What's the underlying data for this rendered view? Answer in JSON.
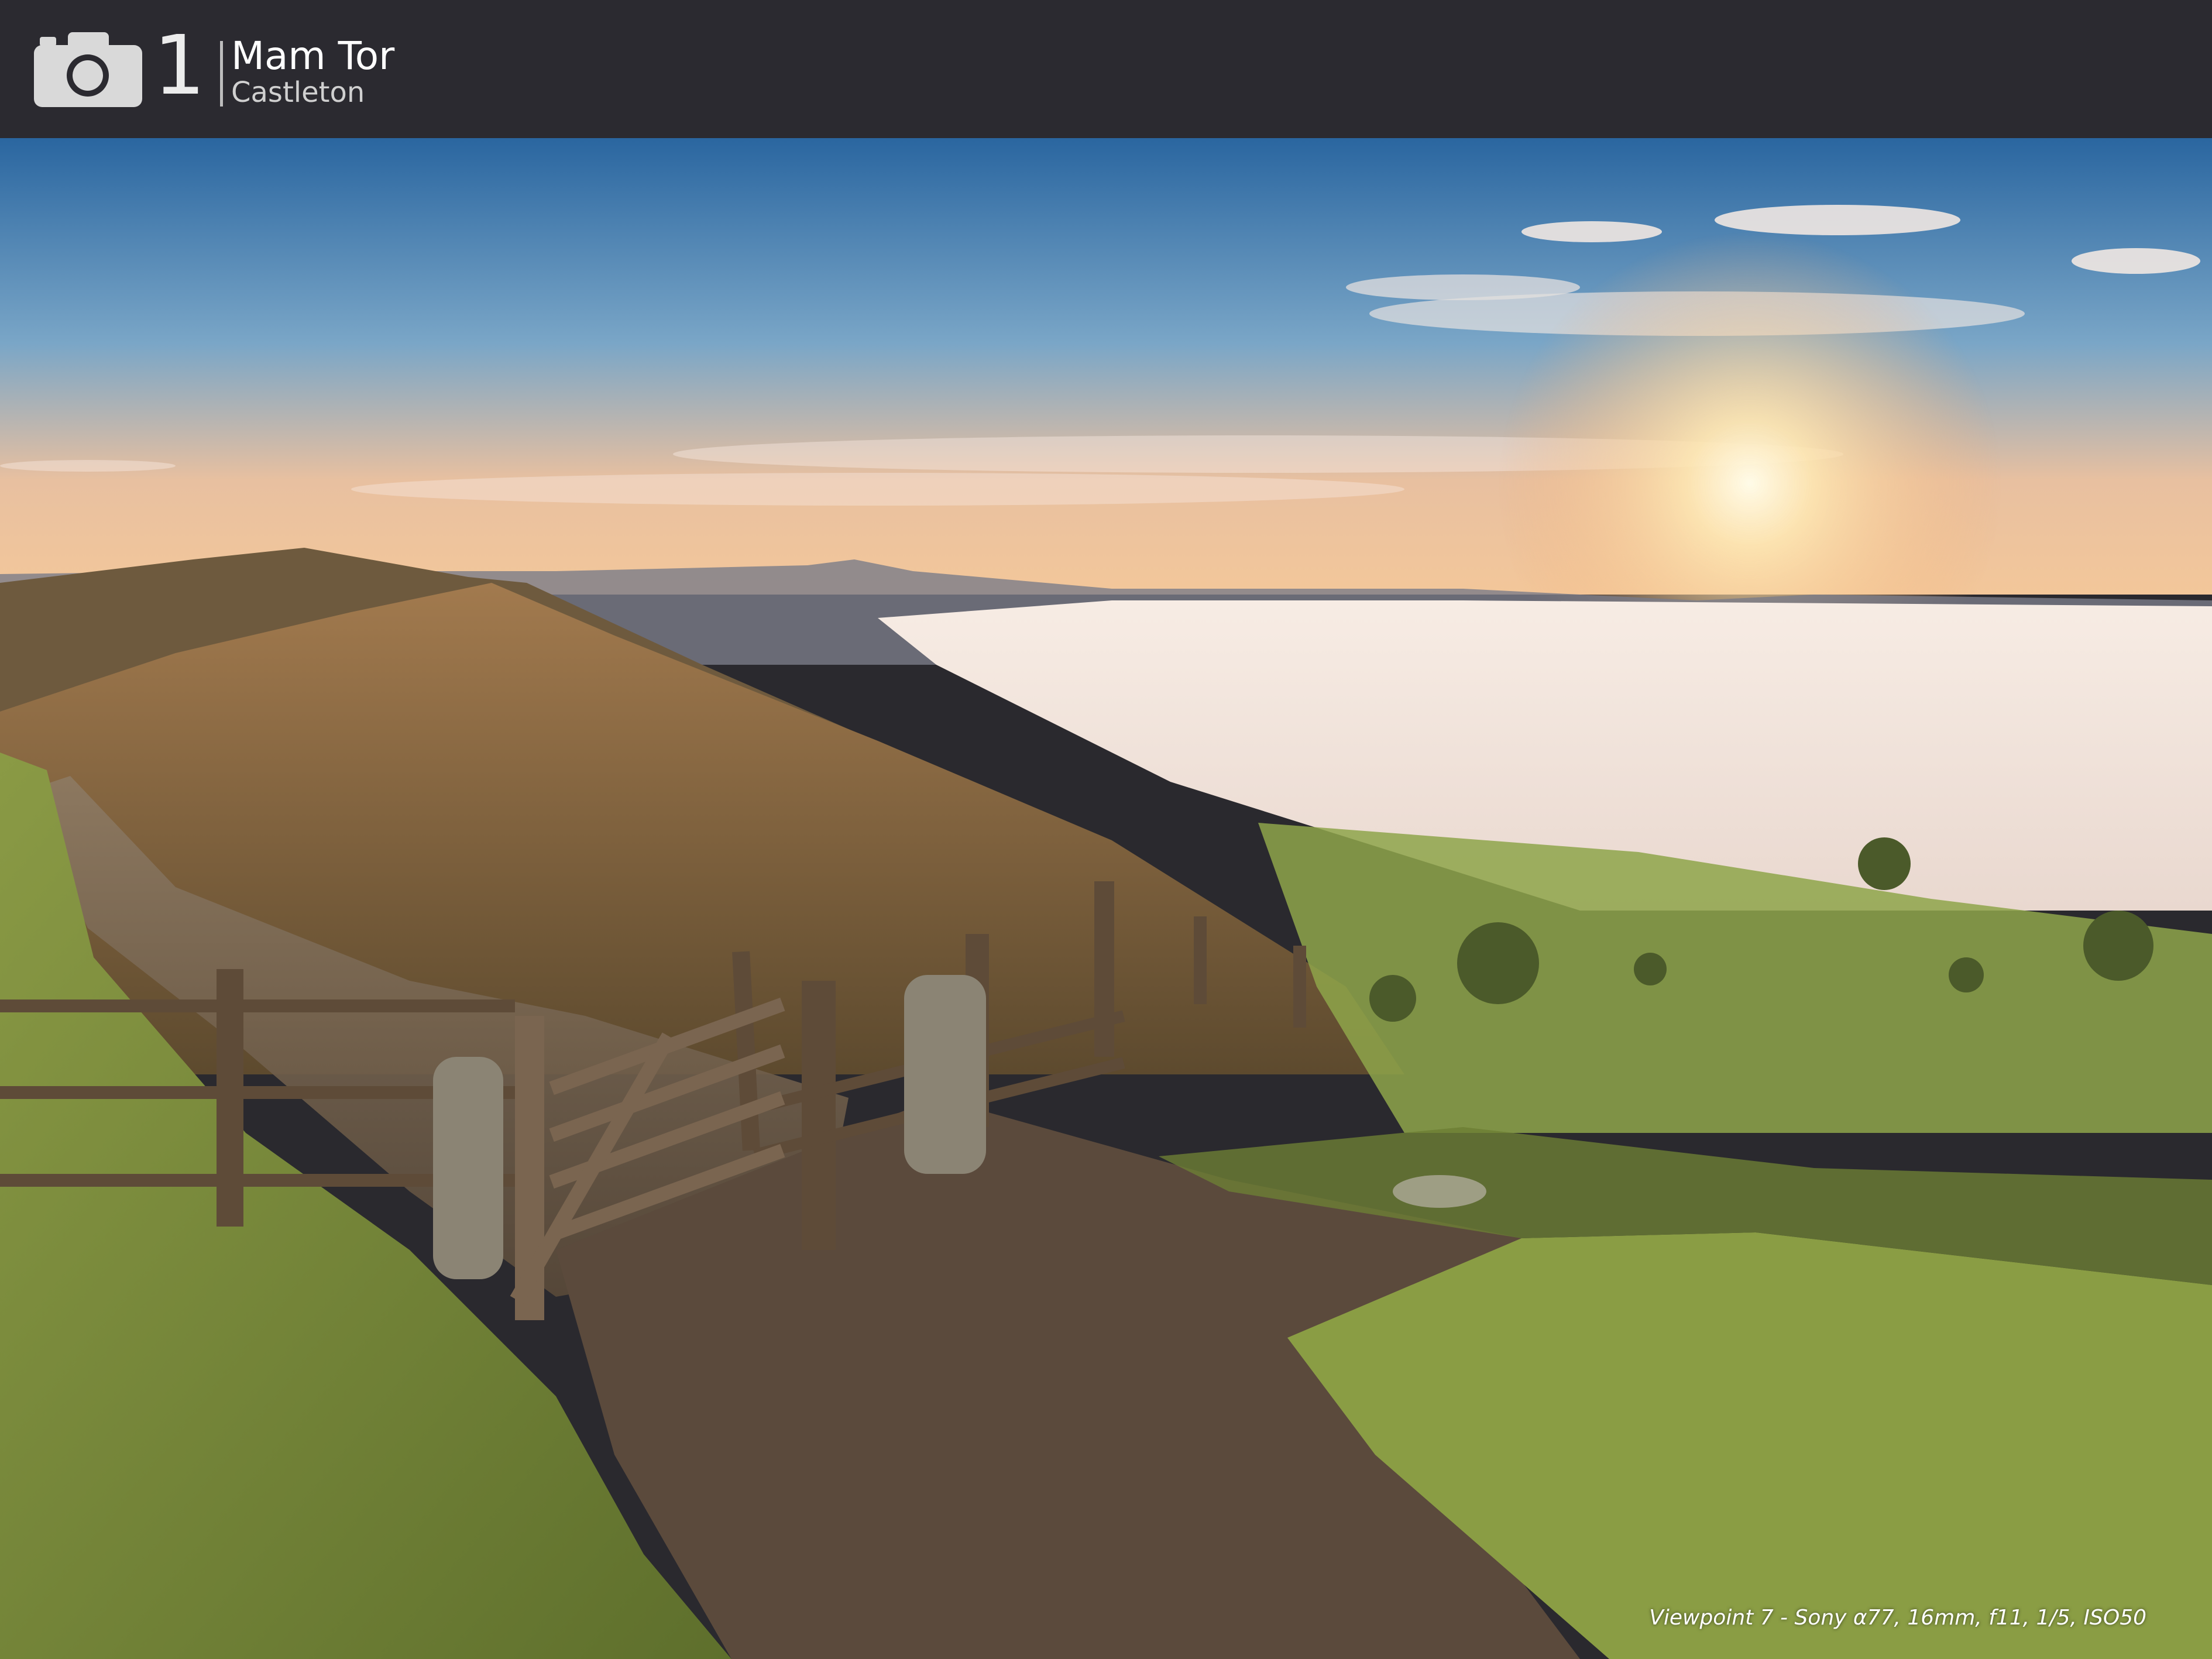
{
  "header": {
    "camera_icon": "camera-icon",
    "number": "1",
    "title": "Mam Tor",
    "subtitle": "Castleton"
  },
  "photo": {
    "caption": "Viewpoint 7 - Sony α77, 16mm, f11, 1/5, ISO50"
  },
  "colors": {
    "header_bg": "#2b2a30",
    "sky_top": "#2f6aa3",
    "sun": "#fff4d6",
    "fog": "#f3e6de",
    "grass": "#7a8b3a"
  }
}
